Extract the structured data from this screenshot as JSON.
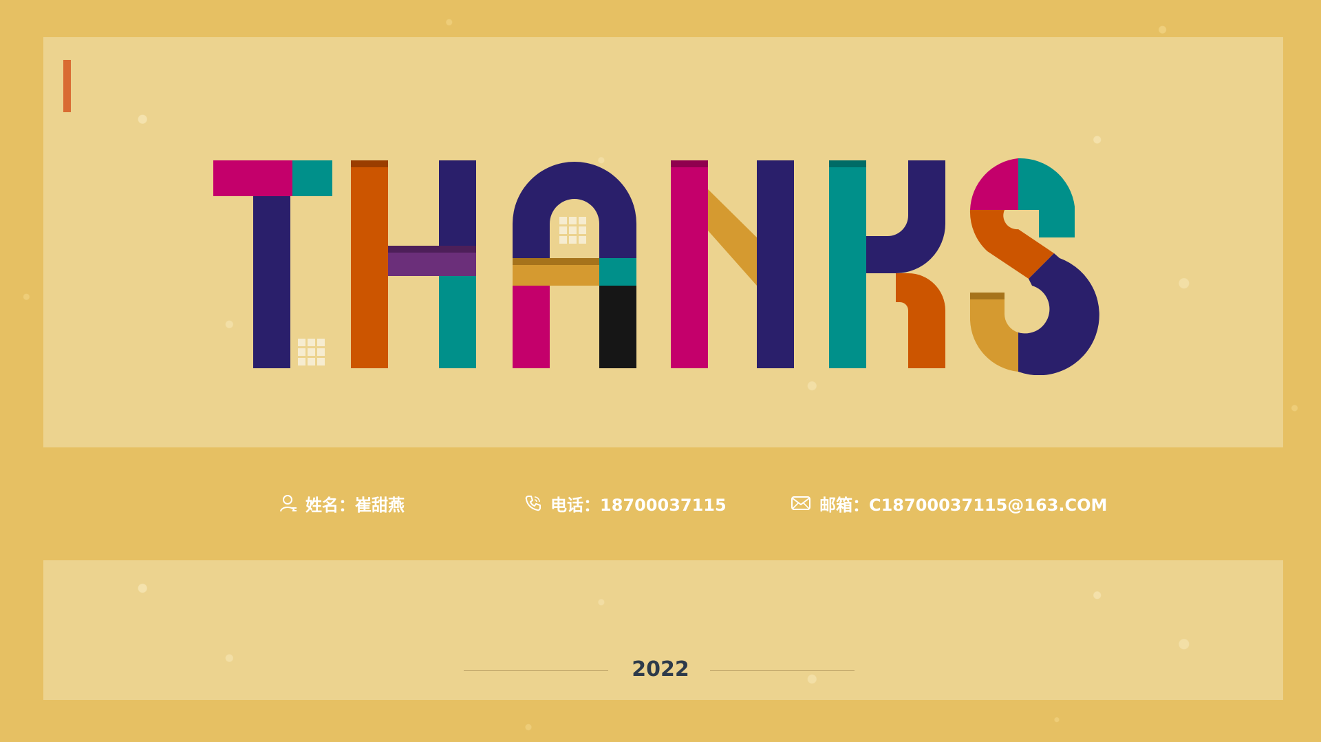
{
  "colors": {
    "frame": "#e6c063",
    "panel": "#ecd38f",
    "accent": "#d96b32",
    "navy": "#2a1f6b",
    "magenta": "#c4006b",
    "teal": "#00908a",
    "orange": "#cc5500",
    "purple": "#6b2f7a",
    "ochre": "#d59a30",
    "black": "#161616"
  },
  "title_art": {
    "letters": [
      "T",
      "H",
      "A",
      "N",
      "K",
      "S"
    ]
  },
  "contact": {
    "name": {
      "icon": "person-icon",
      "text": "姓名：崔甜燕"
    },
    "phone": {
      "icon": "phone-icon",
      "text": "电话：18700037115"
    },
    "email": {
      "icon": "mail-icon",
      "text": "邮箱：C18700037115@163.COM"
    }
  },
  "footer": {
    "year": "2022"
  }
}
